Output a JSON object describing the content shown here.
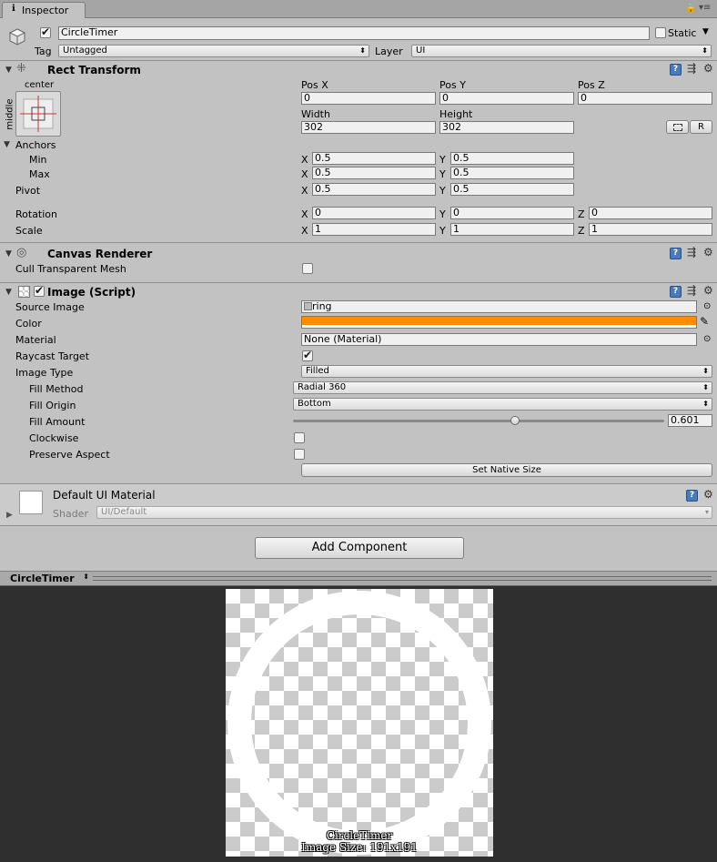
{
  "tab": {
    "label": "Inspector",
    "info_icon": "info-icon"
  },
  "gameobject": {
    "name": "CircleTimer",
    "static_label": "Static",
    "tag_label": "Tag",
    "tag_value": "Untagged",
    "layer_label": "Layer",
    "layer_value": "UI"
  },
  "rect_transform": {
    "title": "Rect Transform",
    "anchor_h": "center",
    "anchor_v": "middle",
    "pos_x_label": "Pos X",
    "pos_y_label": "Pos Y",
    "pos_z_label": "Pos Z",
    "pos_x": "0",
    "pos_y": "0",
    "pos_z": "0",
    "width_label": "Width",
    "height_label": "Height",
    "width": "302",
    "height": "302",
    "r_button": "R",
    "anchors_label": "Anchors",
    "min_label": "Min",
    "max_label": "Max",
    "min_x": "0.5",
    "min_y": "0.5",
    "max_x": "0.5",
    "max_y": "0.5",
    "pivot_label": "Pivot",
    "pivot_x": "0.5",
    "pivot_y": "0.5",
    "rotation_label": "Rotation",
    "rot_x": "0",
    "rot_y": "0",
    "rot_z": "0",
    "scale_label": "Scale",
    "scale_x": "1",
    "scale_y": "1",
    "scale_z": "1",
    "x": "X",
    "y": "Y",
    "z": "Z"
  },
  "canvas_renderer": {
    "title": "Canvas Renderer",
    "cull_label": "Cull Transparent Mesh"
  },
  "image": {
    "title": "Image (Script)",
    "source_label": "Source Image",
    "source_value": "ring",
    "color_label": "Color",
    "color_value": "#ff8c00",
    "material_label": "Material",
    "material_value": "None (Material)",
    "raycast_label": "Raycast Target",
    "image_type_label": "Image Type",
    "image_type_value": "Filled",
    "fill_method_label": "Fill Method",
    "fill_method_value": "Radial 360",
    "fill_origin_label": "Fill Origin",
    "fill_origin_value": "Bottom",
    "fill_amount_label": "Fill Amount",
    "fill_amount_value": "0.601",
    "clockwise_label": "Clockwise",
    "preserve_label": "Preserve Aspect",
    "native_size_button": "Set Native Size"
  },
  "material": {
    "title": "Default UI Material",
    "shader_label": "Shader",
    "shader_value": "UI/Default"
  },
  "add_component": "Add Component",
  "preview": {
    "title": "CircleTimer",
    "caption_name": "CircleTimer",
    "caption_size": "Image Size: 191x191"
  }
}
